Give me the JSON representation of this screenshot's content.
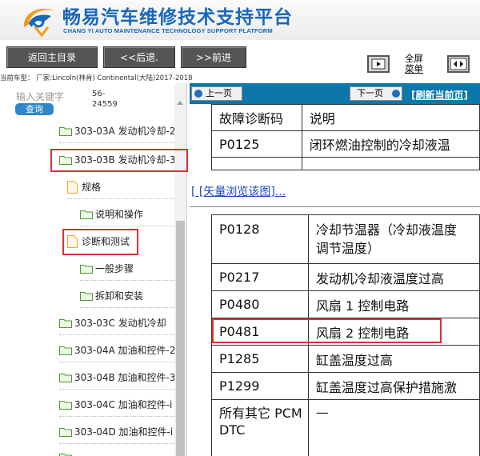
{
  "header": {
    "title_cn": "畅易汽车维修技术支持平台",
    "title_en": "CHANG YI AUTO MAINTENANCE TECHNOLOGY SUPPORT PLATFORM",
    "logo_icon": "cy-swoosh-logo",
    "brand_blue": "#1868b8",
    "brand_orange": "#f39a1e"
  },
  "toolbar": {
    "home_label": "返回主目录",
    "back_label": "<<后退.",
    "forward_label": ">>前进",
    "fullscreen_label_1": "全屏",
    "fullscreen_label_2": "菜单"
  },
  "vehicle_info": "当前车型： 厂家:Lincoln(林肯) Continental(大陆)2017-2018",
  "sidebar": {
    "search_label": "输入关键字",
    "search_button": "查询",
    "search_value_1": "56-",
    "search_value_2": "24559",
    "items": [
      {
        "label": "303-03A 发动机冷却-2",
        "type": "folder"
      },
      {
        "label": "303-03B 发动机冷却-3",
        "type": "folder"
      },
      {
        "label": "规格",
        "type": "doc"
      },
      {
        "label": "说明和操作",
        "type": "folder"
      },
      {
        "label": "诊断和测试",
        "type": "doc"
      },
      {
        "label": "一般步骤",
        "type": "folder"
      },
      {
        "label": "拆卸和安装",
        "type": "folder"
      },
      {
        "label": "303-03C 发动机冷却",
        "type": "folder"
      },
      {
        "label": "303-04A 加油和控件-2",
        "type": "folder"
      },
      {
        "label": "303-04B 加油和控件-3",
        "type": "folder"
      },
      {
        "label": "303-04C 加油和控件-i",
        "type": "folder"
      },
      {
        "label": "303-04D 加油和控件-i",
        "type": "folder"
      }
    ]
  },
  "content": {
    "prev_label": "上一页",
    "next_label": "下一页",
    "refresh_label": "[刷新当前页]",
    "vector_link": "[ [矢量浏览该图]...",
    "table1": {
      "header": [
        "故障诊断码",
        "说明"
      ],
      "rows": [
        [
          "P0125",
          "闭环燃油控制的冷却液温"
        ]
      ]
    },
    "table2": {
      "rows": [
        [
          "P0128",
          "冷却节温器（冷却液温度",
          "调节温度）"
        ],
        [
          "P0217",
          "发动机冷却液温度过高",
          ""
        ],
        [
          "P0480",
          "风扇 1 控制电路",
          ""
        ],
        [
          "P0481",
          "风扇 2 控制电路",
          ""
        ],
        [
          "P1285",
          "缸盖温度过高",
          ""
        ],
        [
          "P1299",
          "缸盖温度过高保护措施激",
          ""
        ],
        [
          "所有其它 PCM",
          "—",
          ""
        ]
      ],
      "last_row_line2": "DTC"
    },
    "bar_color": "#0c77a8"
  },
  "highlight_color": "#e03030"
}
